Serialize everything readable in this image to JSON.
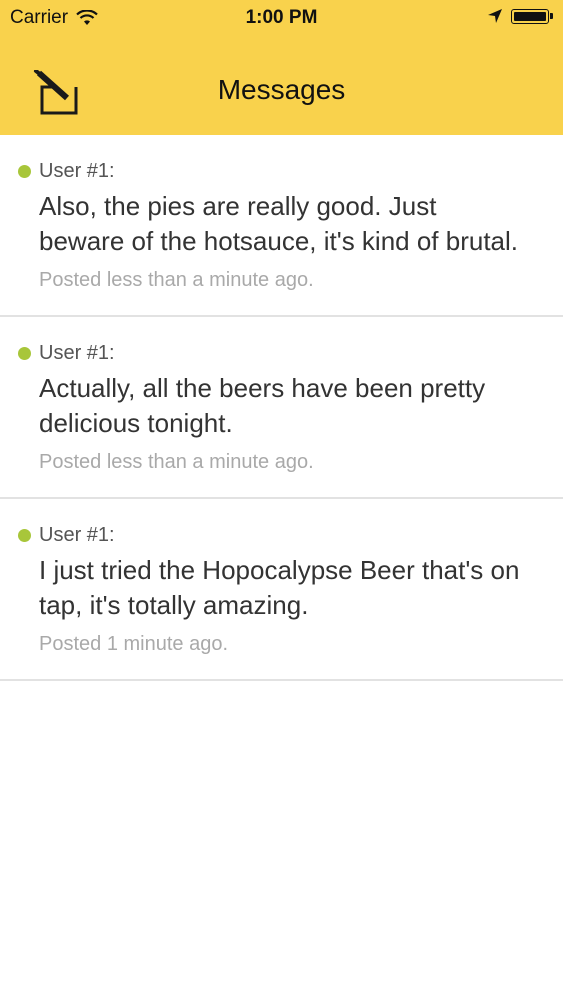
{
  "status_bar": {
    "carrier": "Carrier",
    "time": "1:00 PM",
    "icons": [
      "wifi-icon",
      "location-arrow-icon",
      "battery-icon"
    ]
  },
  "nav": {
    "title": "Messages",
    "compose_icon": "compose-icon"
  },
  "colors": {
    "header_bg": "#f9d24c",
    "status_dot": "#a8c63a",
    "divider": "#e2e2e2",
    "timestamp": "#a9a9a9"
  },
  "messages": [
    {
      "author": "User #1:",
      "text": "Also, the pies are really good. Just beware of the hotsauce, it's kind of brutal.",
      "posted": "Posted less than a minute ago."
    },
    {
      "author": "User #1:",
      "text": "Actually, all the beers have been pretty delicious tonight.",
      "posted": "Posted less than a minute ago."
    },
    {
      "author": "User #1:",
      "text": "I just tried the Hopocalypse Beer that's on tap, it's totally amazing.",
      "posted": "Posted 1 minute ago."
    }
  ]
}
